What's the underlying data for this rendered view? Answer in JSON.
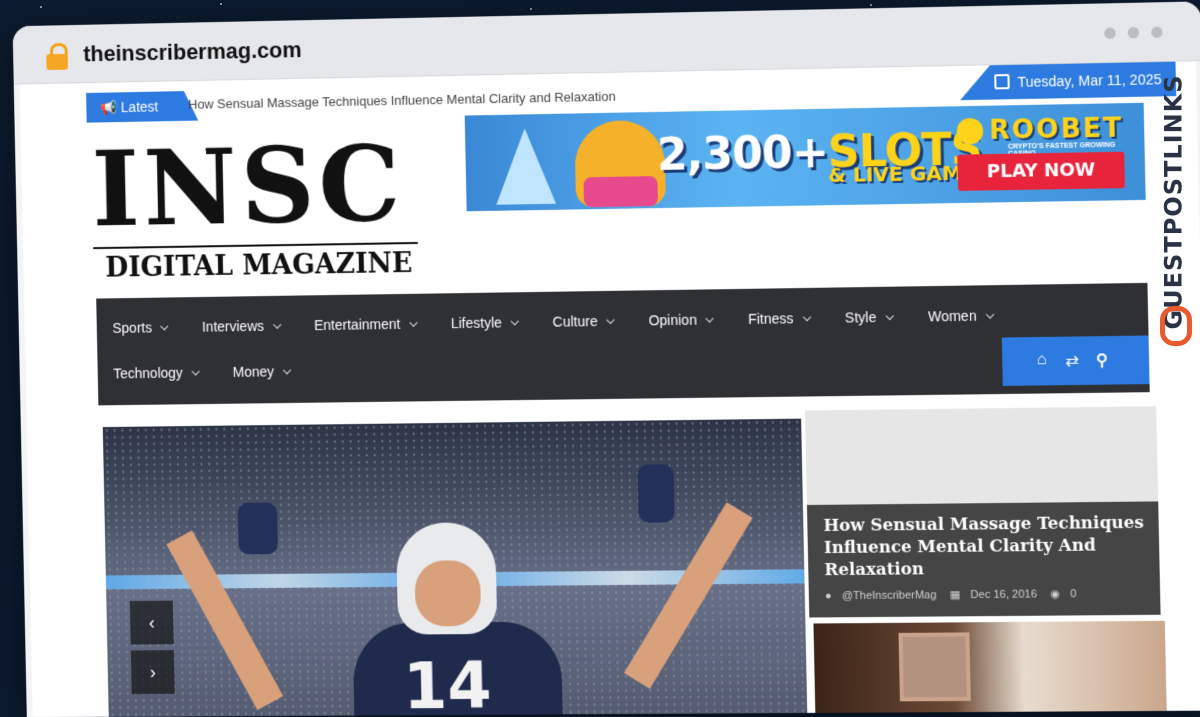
{
  "browser": {
    "url": "theinscribermag.com"
  },
  "topbar": {
    "latest_label": "Latest",
    "ticker_text": "How Sensual Massage Techniques Influence Mental Clarity and Relaxation",
    "date": "Tuesday, Mar 11, 2025"
  },
  "logo": {
    "main": "INSC",
    "sub": "DIGITAL MAGAZINE"
  },
  "ad": {
    "headline_num": "2,300+",
    "headline_word": "SLOTS",
    "subline": "& LIVE GAMES",
    "brand": "ROOBET",
    "tagline": "CRYPTO'S FASTEST GROWING CASINO",
    "cta": "PLAY NOW"
  },
  "nav": {
    "row1": [
      "Sports",
      "Interviews",
      "Entertainment",
      "Lifestyle",
      "Culture",
      "Opinion",
      "Fitness",
      "Style",
      "Women"
    ],
    "row2": [
      "Technology",
      "Money"
    ],
    "tools": [
      "home-icon",
      "shuffle-icon",
      "search-icon"
    ]
  },
  "hero": {
    "jersey_number": "14",
    "prev": "‹",
    "next": "›"
  },
  "featured": {
    "title": "How Sensual Massage Techniques Influence Mental Clarity And Relaxation",
    "author": "@TheInscriberMag",
    "date": "Dec 16, 2016",
    "comments": "0"
  },
  "watermark": {
    "text": "GUESTPOSTLINKS"
  },
  "colors": {
    "accent": "#2d7be0",
    "nav_bg": "#2f3033",
    "watermark_icon": "#ea5a2e"
  }
}
